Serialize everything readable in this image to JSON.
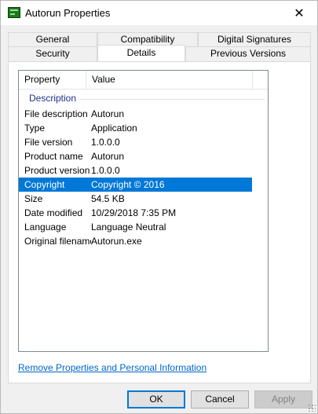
{
  "window": {
    "title": "Autorun Properties",
    "close_glyph": "✕"
  },
  "tabs": {
    "back_row": [
      {
        "label": "General"
      },
      {
        "label": "Compatibility"
      },
      {
        "label": "Digital Signatures"
      }
    ],
    "front_row": [
      {
        "label": "Security",
        "active": false
      },
      {
        "label": "Details",
        "active": true
      },
      {
        "label": "Previous Versions",
        "active": false
      }
    ]
  },
  "details": {
    "columns": {
      "property": "Property",
      "value": "Value"
    },
    "group": "Description",
    "rows": [
      {
        "property": "File description",
        "value": "Autorun",
        "selected": false
      },
      {
        "property": "Type",
        "value": "Application",
        "selected": false
      },
      {
        "property": "File version",
        "value": "1.0.0.0",
        "selected": false
      },
      {
        "property": "Product name",
        "value": "Autorun",
        "selected": false
      },
      {
        "property": "Product version",
        "value": "1.0.0.0",
        "selected": false
      },
      {
        "property": "Copyright",
        "value": "Copyright © 2016",
        "selected": true
      },
      {
        "property": "Size",
        "value": "54.5 KB",
        "selected": false
      },
      {
        "property": "Date modified",
        "value": "10/29/2018 7:35 PM",
        "selected": false
      },
      {
        "property": "Language",
        "value": "Language Neutral",
        "selected": false
      },
      {
        "property": "Original filename",
        "value": "Autorun.exe",
        "selected": false
      }
    ],
    "remove_link": "Remove Properties and Personal Information"
  },
  "buttons": {
    "ok": "OK",
    "cancel": "Cancel",
    "apply": "Apply"
  },
  "colors": {
    "selection": "#0078d7",
    "link": "#0066cc",
    "group_header": "#1e3287"
  },
  "icons": {
    "app": "application-icon",
    "close": "close-icon"
  }
}
